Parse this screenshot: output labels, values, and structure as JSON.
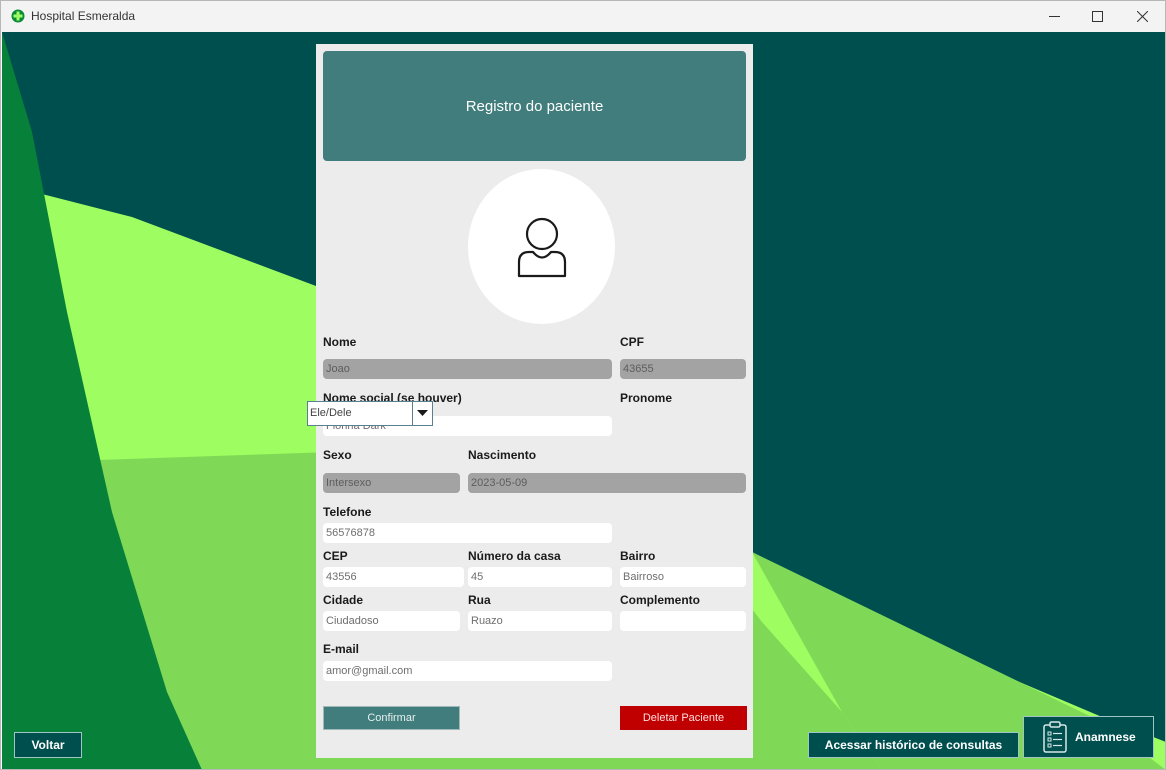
{
  "window": {
    "title": "Hospital Esmeralda"
  },
  "form": {
    "title": "Registro do paciente",
    "fields": {
      "nome": {
        "label": "Nome",
        "value": "Joao"
      },
      "cpf": {
        "label": "CPF",
        "value": "43655"
      },
      "nome_social": {
        "label": "Nome social (se houver)",
        "value": "Fionna Dark"
      },
      "pronome": {
        "label": "Pronome",
        "value": "Ele/Dele"
      },
      "sexo": {
        "label": "Sexo",
        "value": "Intersexo"
      },
      "nascimento": {
        "label": "Nascimento",
        "value": "2023-05-09"
      },
      "telefone": {
        "label": "Telefone",
        "value": "56576878"
      },
      "cep": {
        "label": "CEP",
        "value": "43556"
      },
      "numero_casa": {
        "label": "Número da casa",
        "value": "45"
      },
      "bairro": {
        "label": "Bairro",
        "value": "Bairroso"
      },
      "cidade": {
        "label": "Cidade",
        "value": "Ciudadoso"
      },
      "rua": {
        "label": "Rua",
        "value": "Ruazo"
      },
      "complemento": {
        "label": "Complemento",
        "value": ""
      },
      "email": {
        "label": "E-mail",
        "value": "amor@gmail.com"
      }
    },
    "confirm_label": "Confirmar",
    "delete_label": "Deletar Paciente"
  },
  "actions": {
    "back_label": "Voltar",
    "history_label": "Acessar histórico de consultas",
    "anamnese_label": "Anamnese"
  },
  "icons": {
    "app": "emerald-cross-icon",
    "avatar": "user-icon",
    "anamnese": "clipboard-list-icon",
    "dropdown": "chevron-down-icon"
  },
  "colors": {
    "background": "#004f4f",
    "accent_teal": "#427d7d",
    "danger": "#c00000",
    "light_green": "#9efd60",
    "mid_green": "#7fd957",
    "dark_green": "#07803a"
  }
}
